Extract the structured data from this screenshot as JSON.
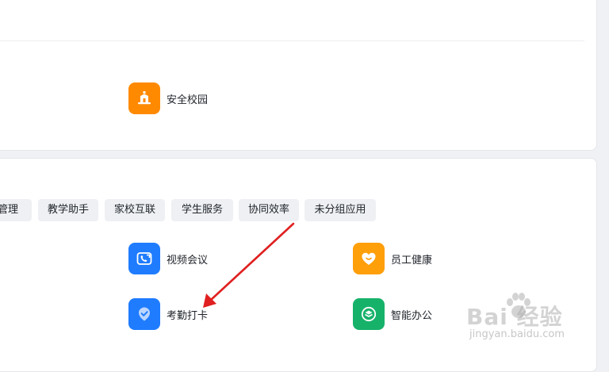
{
  "top_section": {
    "apps": [
      {
        "label": "安全校园",
        "icon": "campus-building-icon",
        "color": "#ff8a00"
      }
    ]
  },
  "bottom_section": {
    "tabs": [
      {
        "label": "管理"
      },
      {
        "label": "教学助手"
      },
      {
        "label": "家校互联"
      },
      {
        "label": "学生服务"
      },
      {
        "label": "协同效率"
      },
      {
        "label": "未分组应用"
      }
    ],
    "apps": [
      {
        "label": "视频会议",
        "icon": "video-call-icon",
        "color": "#1f7cff"
      },
      {
        "label": "员工健康",
        "icon": "heart-icon",
        "color": "#ff9f0a"
      },
      {
        "label": "考勤打卡",
        "icon": "check-shield-icon",
        "color": "#1f7cff"
      },
      {
        "label": "智能办公",
        "icon": "layers-icon",
        "color": "#17b26a"
      }
    ]
  },
  "annotation": {
    "color": "#e02020"
  },
  "watermark": {
    "brand": "Bai  经验",
    "url": "jingyan.baidu.com"
  }
}
